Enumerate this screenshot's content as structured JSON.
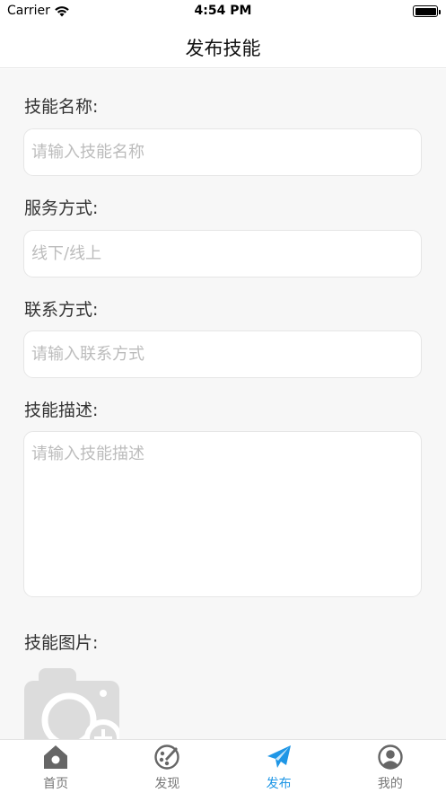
{
  "status_bar": {
    "carrier": "Carrier",
    "time": "4:54 PM"
  },
  "nav": {
    "title": "发布技能"
  },
  "form": {
    "skill_name": {
      "label": "技能名称:",
      "placeholder": "请输入技能名称"
    },
    "service_mode": {
      "label": "服务方式:",
      "placeholder": "线下/线上"
    },
    "contact": {
      "label": "联系方式:",
      "placeholder": "请输入联系方式"
    },
    "description": {
      "label": "技能描述:",
      "placeholder": "请输入技能描述"
    },
    "images": {
      "label": "技能图片:",
      "icon": "camera-add-icon"
    }
  },
  "tabs": [
    {
      "label": "首页",
      "icon": "home-icon",
      "active": false
    },
    {
      "label": "发现",
      "icon": "palette-icon",
      "active": false
    },
    {
      "label": "发布",
      "icon": "paper-plane-icon",
      "active": true
    },
    {
      "label": "我的",
      "icon": "user-icon",
      "active": false
    }
  ],
  "colors": {
    "accent": "#1e96e6",
    "tab_inactive": "#777777",
    "placeholder": "#bcbcbc",
    "background": "#f7f7f7"
  }
}
